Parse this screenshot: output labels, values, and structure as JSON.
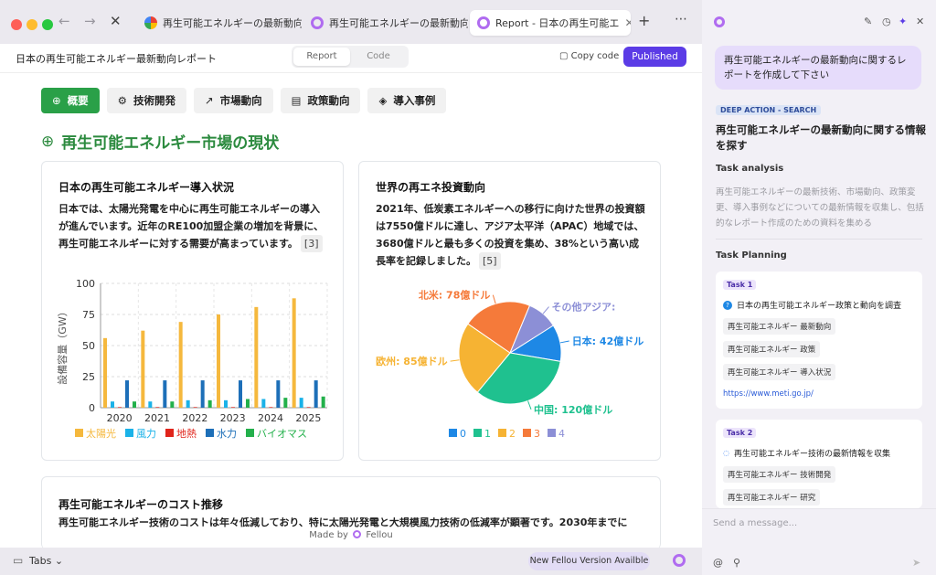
{
  "browser": {
    "tabs": [
      {
        "title": "再生可能エネルギーの最新動向を",
        "icon": "google-icon",
        "active": false
      },
      {
        "title": "再生可能エネルギーの最新動向",
        "icon": "fellou-icon",
        "active": false
      },
      {
        "title": "Report - 日本の再生可能エ",
        "icon": "fellou-icon",
        "active": true
      }
    ],
    "add_tab": "+",
    "more": "⋯"
  },
  "page": {
    "title": "日本の再生可能エネルギー最新動向レポート",
    "toggle": [
      "Report",
      "Code"
    ],
    "copy_label": "Copy code",
    "publish_label": "Published",
    "section_tabs": [
      "概要",
      "技術開発",
      "市場動向",
      "政策動向",
      "導入事例"
    ],
    "section_title": "再生可能エネルギー市場の現状",
    "card1": {
      "title": "日本の再生可能エネルギー導入状況",
      "text": "日本では、太陽光発電を中心に再生可能エネルギーの導入が進んでいます。近年のRE100加盟企業の増加を背景に、再生可能エネルギーに対する需要が高まっています。",
      "cite": "[3]"
    },
    "card2": {
      "title": "世界の再エネ投資動向",
      "text": "2021年、低炭素エネルギーへの移行に向けた世界の投資額は7550億ドルに達し、アジア太平洋（APAC）地域では、3680億ドルと最も多くの投資を集め、38%という高い成長率を記録しました。",
      "cite": "[5]"
    },
    "card3": {
      "title": "再生可能エネルギーのコスト推移",
      "text": "再生可能エネルギー技術のコストは年々低減しており、特に太陽光発電と大規模風力技術の低減率が顕著です。2030年までに"
    },
    "made_by": "Made by",
    "brand": "Fellou"
  },
  "chart_data": [
    {
      "type": "bar",
      "ylabel": "設備容量（GW）",
      "ylim": [
        0,
        100
      ],
      "yticks": [
        0,
        25,
        50,
        75,
        100
      ],
      "categories": [
        "2020",
        "2021",
        "2022",
        "2023",
        "2024",
        "2025"
      ],
      "series": [
        {
          "name": "太陽光",
          "color": "#f5b83d",
          "values": [
            56,
            62,
            69,
            75,
            81,
            88
          ]
        },
        {
          "name": "風力",
          "color": "#1ab2e8",
          "values": [
            5,
            5,
            6,
            6,
            7,
            8
          ]
        },
        {
          "name": "地熱",
          "color": "#e0241b",
          "values": [
            0.5,
            0.5,
            0.5,
            0.5,
            0.5,
            0.5
          ]
        },
        {
          "name": "水力",
          "color": "#1d6fb8",
          "values": [
            22,
            22,
            22,
            22,
            22,
            22
          ]
        },
        {
          "name": "バイオマス",
          "color": "#23b04b",
          "values": [
            5,
            5,
            6,
            7,
            8,
            9
          ]
        }
      ],
      "grid": true,
      "legend": "bottom"
    },
    {
      "type": "pie",
      "slices": [
        {
          "label": "日本: 42億ドル",
          "legend": "0",
          "value": 42,
          "color": "#1e88e5"
        },
        {
          "label": "中国: 120億ドル",
          "legend": "1",
          "value": 120,
          "color": "#1fc18f"
        },
        {
          "label": "欧州: 85億ドル",
          "legend": "2",
          "value": 85,
          "color": "#f6b333"
        },
        {
          "label": "北米: 78億ドル",
          "legend": "3",
          "value": 78,
          "color": "#f57a3a"
        },
        {
          "label": "その他アジア:",
          "legend": "4",
          "value": 35,
          "color": "#8c8fd6"
        }
      ],
      "legend": "bottom"
    }
  ],
  "bottom": {
    "tabs_label": "Tabs",
    "new_version": "New Fellou Version Availble"
  },
  "side": {
    "user_message": "再生可能エネルギーの最新動向に関するレポートを作成して下さい",
    "badge": "DEEP ACTION - SEARCH",
    "heading": "再生可能エネルギーの最新動向に関する情報を探す",
    "analysis_label": "Task analysis",
    "analysis_text": "再生可能エネルギーの最新技術、市場動向、政策変更、導入事例などについての最新情報を収集し、包括的なレポート作成のための資料を集める",
    "planning_label": "Task Planning",
    "tasks": [
      {
        "badge": "Task 1",
        "title": "日本の再生可能エネルギー政策と動向を調査",
        "chips": [
          "再生可能エネルギー 最新動向",
          "再生可能エネルギー 政策",
          "再生可能エネルギー 導入状況"
        ],
        "url": "https://www.meti.go.jp/"
      },
      {
        "badge": "Task 2",
        "title": "再生可能エネルギー技術の最新情報を収集",
        "chips": [
          "再生可能エネルギー 技術開発",
          "再生可能エネルギー 研究"
        ]
      }
    ],
    "input_placeholder": "Send a message..."
  }
}
